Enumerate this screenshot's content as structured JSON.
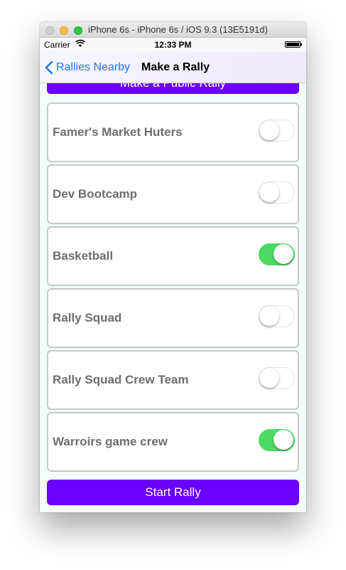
{
  "window": {
    "title": "iPhone 6s - iPhone 6s / iOS 9.3 (13E5191d)"
  },
  "status_bar": {
    "carrier": "Carrier",
    "time": "12:33 PM"
  },
  "nav": {
    "back_label": "Rallies Nearby",
    "title": "Make a Rally"
  },
  "public_button_label": "Make a Public Rally",
  "rallies": [
    {
      "name": "Famer's Market Huters",
      "enabled": false
    },
    {
      "name": "Dev Bootcamp",
      "enabled": false
    },
    {
      "name": "Basketball",
      "enabled": true
    },
    {
      "name": "Rally Squad",
      "enabled": false
    },
    {
      "name": "Rally Squad Crew Team",
      "enabled": false
    },
    {
      "name": "Warroirs game crew",
      "enabled": true
    }
  ],
  "start_button_label": "Start Rally",
  "colors": {
    "accent_purple": "#6b00ff",
    "toggle_on": "#4cd964",
    "link_blue": "#1a7cf5"
  }
}
